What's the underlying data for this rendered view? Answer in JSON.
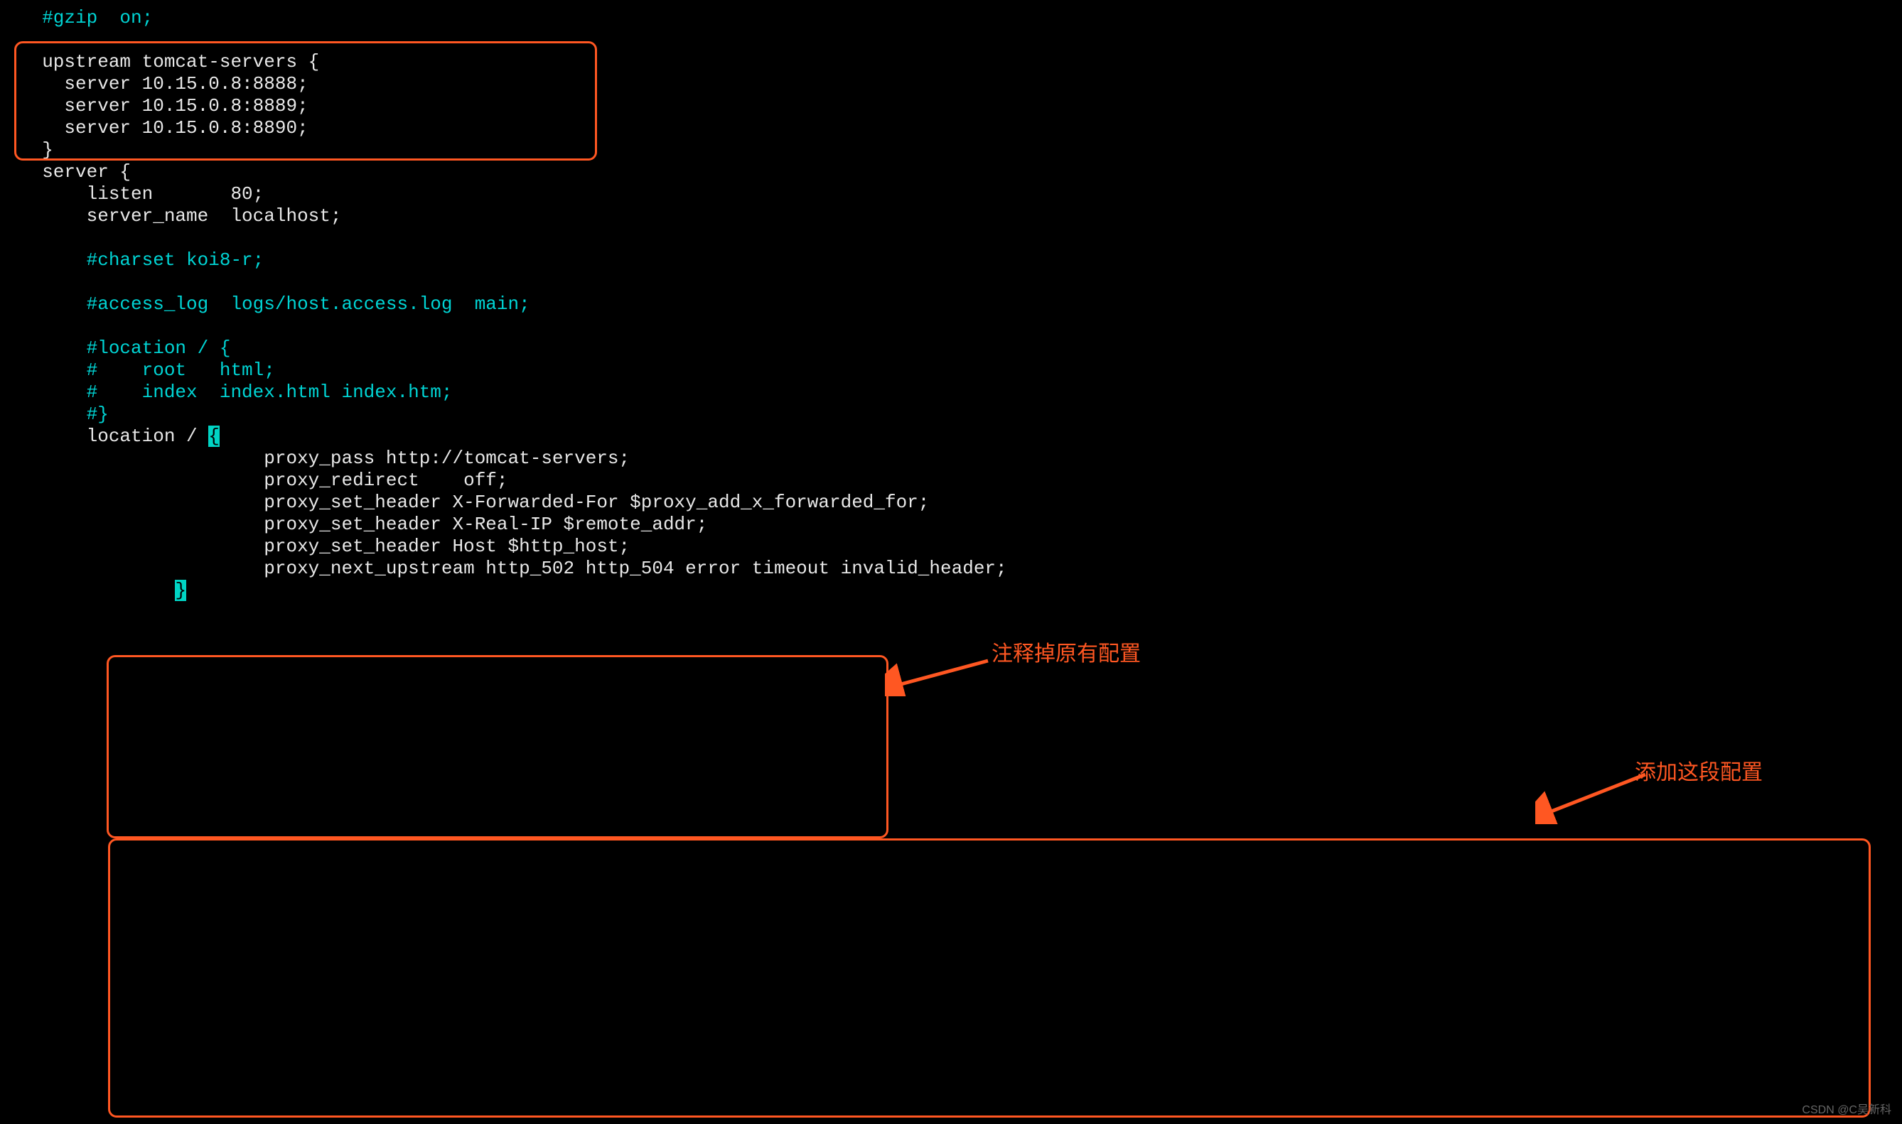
{
  "lines": {
    "l1": "  #gzip  on;",
    "l2": "",
    "l3": "  upstream tomcat-servers {",
    "l4": "    server 10.15.0.8:8888;",
    "l5": "    server 10.15.0.8:8889;",
    "l6": "    server 10.15.0.8:8890;",
    "l7": "  }",
    "l8": "  server {",
    "l9": "      listen       80;",
    "l10": "      server_name  localhost;",
    "l11": "",
    "l12": "      #charset koi8-r;",
    "l13": "",
    "l14": "      #access_log  logs/host.access.log  main;",
    "l15": "",
    "l16": "      #location / {",
    "l17": "      #    root   html;",
    "l18": "      #    index  index.html index.htm;",
    "l19": "      #}",
    "l20a": "      location / ",
    "l20b": "{",
    "l21": "                      proxy_pass http://tomcat-servers;",
    "l22": "                      proxy_redirect    off;",
    "l23": "                      proxy_set_header X-Forwarded-For $proxy_add_x_forwarded_for;",
    "l24": "                      proxy_set_header X-Real-IP $remote_addr;",
    "l25": "                      proxy_set_header Host $http_host;",
    "l26": "                      proxy_next_upstream http_502 http_504 error timeout invalid_header;",
    "l27a": "              ",
    "l27b": "}"
  },
  "annotations": {
    "comment_original": "注释掉原有配置",
    "add_this": "添加这段配置"
  },
  "watermark": "CSDN @C吴新科"
}
